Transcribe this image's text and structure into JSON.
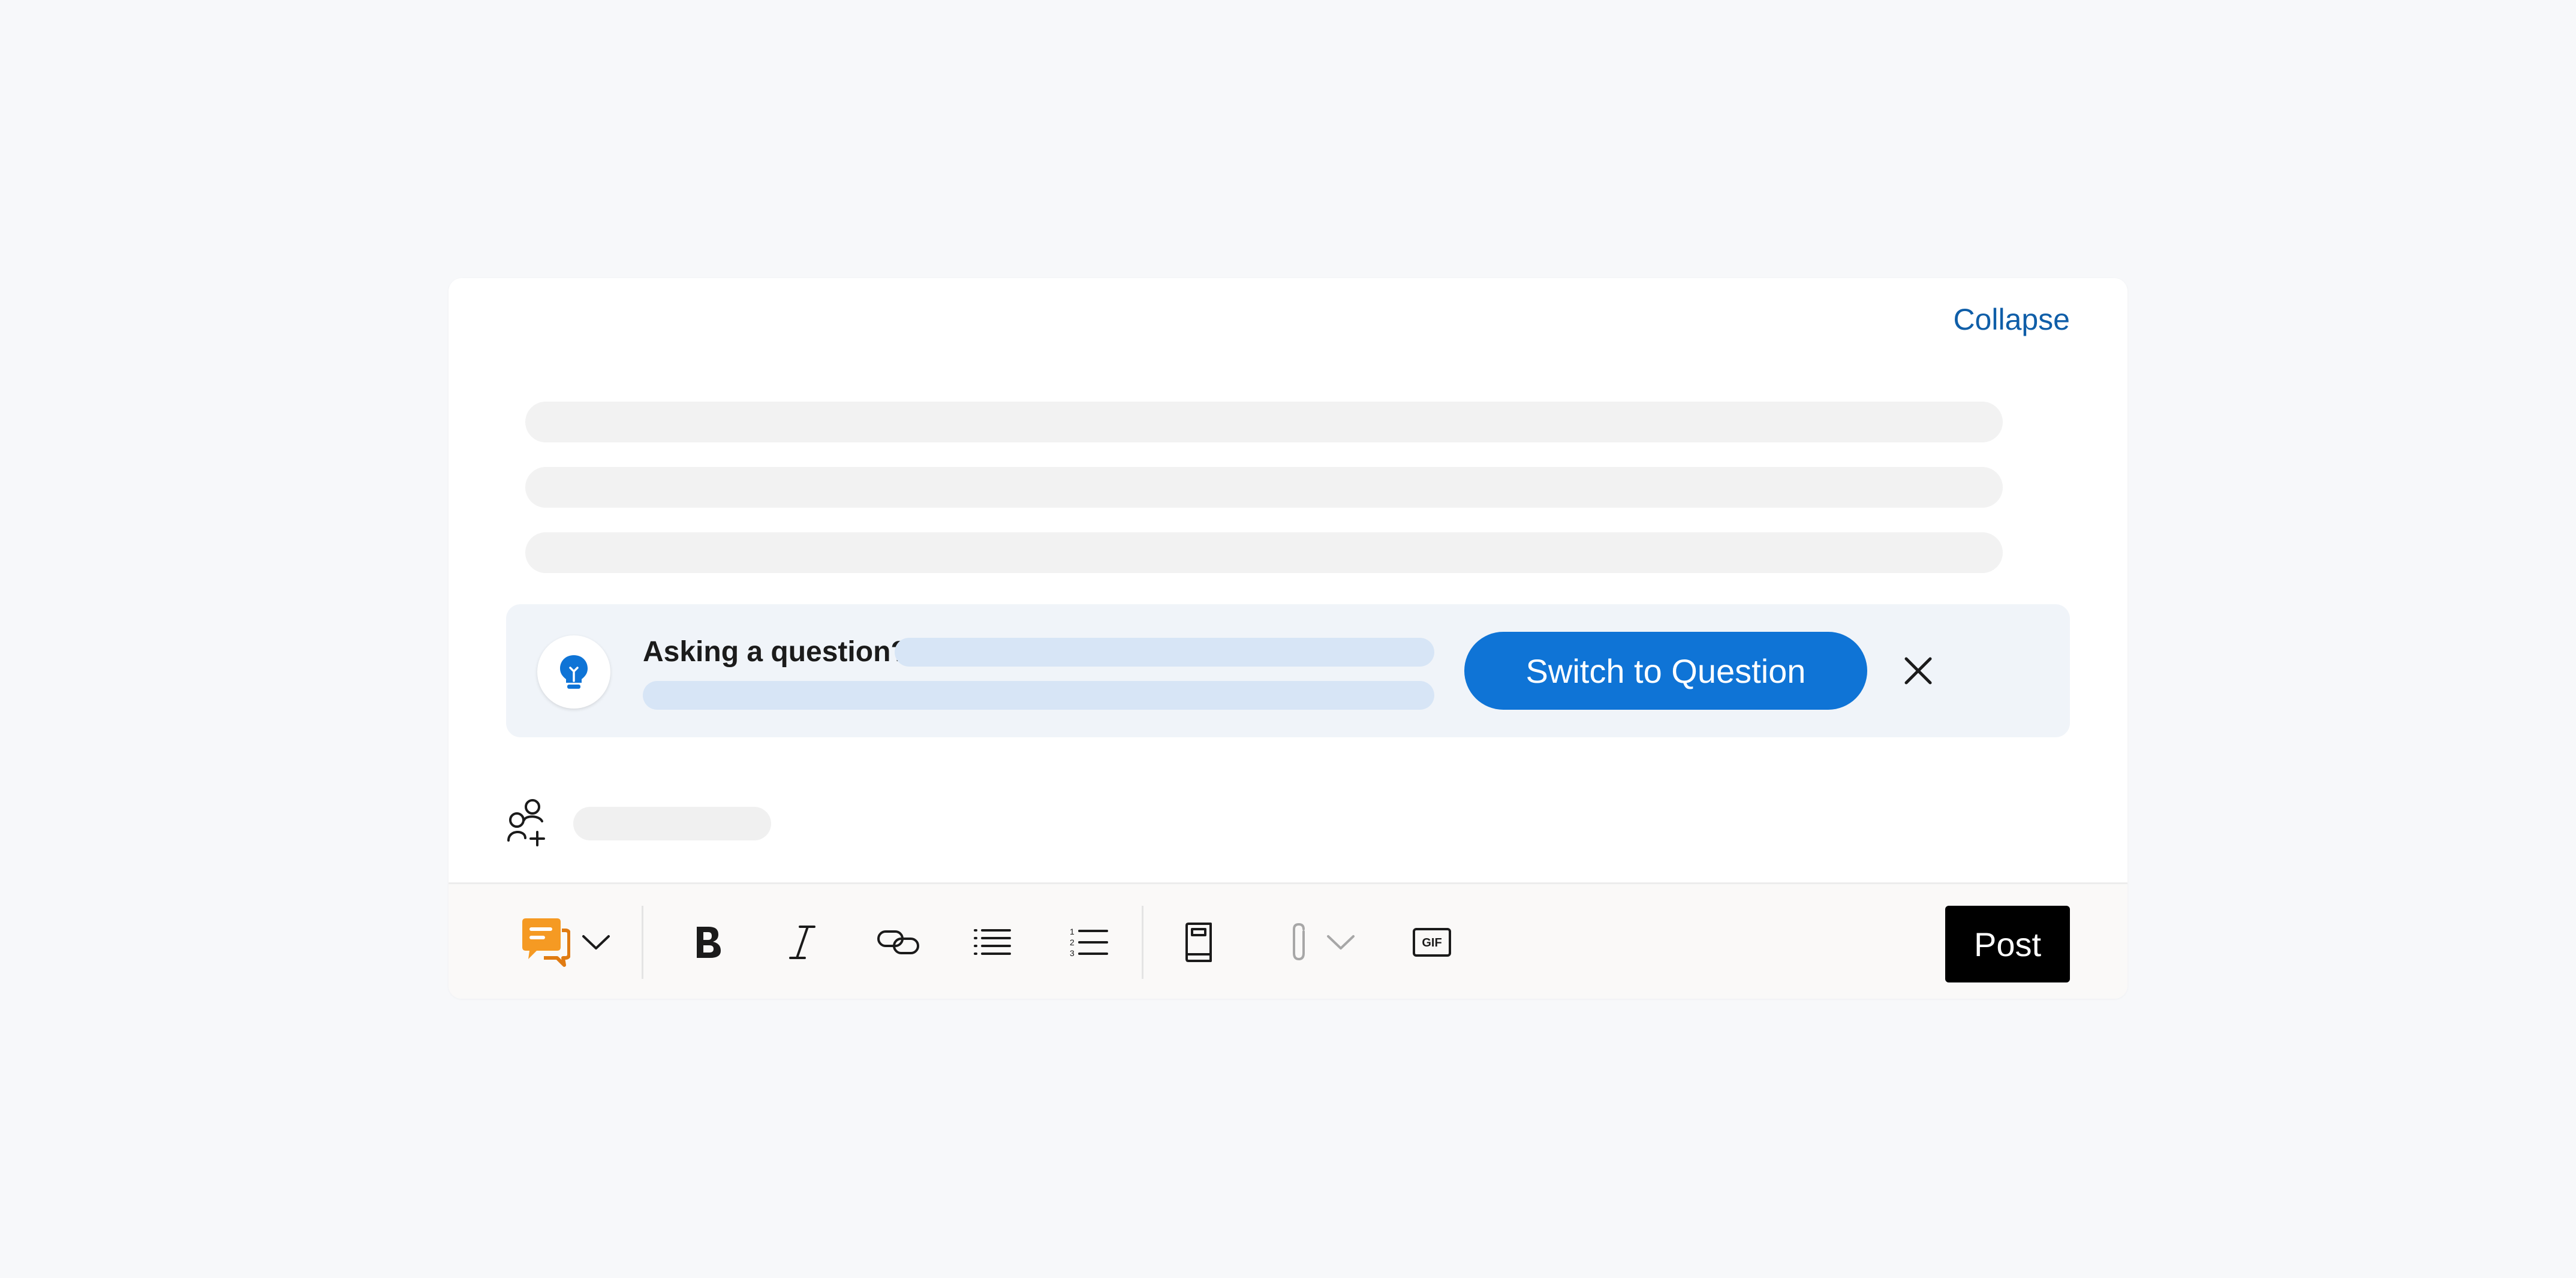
{
  "composer": {
    "collapse_label": "Collapse"
  },
  "banner": {
    "title": "Asking a question?",
    "switch_label": "Switch to Question",
    "icon": "lightbulb-icon",
    "close_icon": "close-icon"
  },
  "mention": {
    "icon": "add-people-icon"
  },
  "toolbar": {
    "items": [
      {
        "name": "post-type-icon",
        "label": "Post type"
      },
      {
        "name": "chevron-down-icon",
        "label": "More post types"
      },
      {
        "name": "bold-icon",
        "label": "Bold"
      },
      {
        "name": "italic-icon",
        "label": "Italic"
      },
      {
        "name": "link-icon",
        "label": "Link"
      },
      {
        "name": "bulleted-list-icon",
        "label": "Bulleted list"
      },
      {
        "name": "numbered-list-icon",
        "label": "Numbered list"
      },
      {
        "name": "book-icon",
        "label": "Book"
      },
      {
        "name": "attachment-icon",
        "label": "Attach"
      },
      {
        "name": "gif-icon",
        "label": "GIF"
      }
    ],
    "post_label": "Post"
  },
  "colors": {
    "accent": "#0f74d6",
    "link": "#0f5ea8",
    "banner_bg": "#f0f4f9",
    "post_type_orange": "#f59a23",
    "post_button": "#000000"
  }
}
